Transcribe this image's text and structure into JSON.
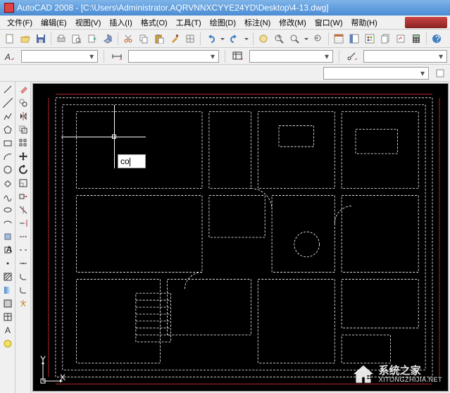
{
  "title": "AutoCAD 2008 - [C:\\Users\\Administrator.AQRVNNXCYYE24YD\\Desktop\\4-13.dwg]",
  "menu": {
    "file": "文件(F)",
    "edit": "编辑(E)",
    "view": "视图(V)",
    "insert": "插入(I)",
    "format": "格式(O)",
    "tools": "工具(T)",
    "draw": "绘图(D)",
    "dimension": "标注(N)",
    "modify": "修改(M)",
    "window": "窗口(W)",
    "help": "帮助(H)"
  },
  "toolbar_icons": {
    "new": "□",
    "open": "📂",
    "save": "💾",
    "plot": "🖶",
    "preview": "🔍",
    "publish": "📤",
    "cut": "✂",
    "copy": "📋",
    "paste": "📄",
    "match": "🖌",
    "undo": "↶",
    "redo": "↷",
    "pan": "✋",
    "zoomrt": "🔍",
    "zoomw": "⊞",
    "zoomp": "⊟",
    "props": "📑",
    "dc": "🗂",
    "tp": "🎨",
    "sheet": "📊",
    "markup": "✎",
    "calc": "🖩",
    "help": "?"
  },
  "props": {
    "color_label": "",
    "layer_label": "",
    "ltype_label": "",
    "lweight_label": ""
  },
  "cmd_input": "co",
  "ucs": {
    "x": "X",
    "y": "Y"
  },
  "watermark": {
    "cn": "系统之家",
    "en": "XITONGZHIJIA.NET"
  },
  "left_tools": [
    "line",
    "xline",
    "pline",
    "polygon",
    "rect",
    "arc",
    "circle",
    "revcloud",
    "spline",
    "ellipse",
    "earc",
    "block",
    "point",
    "hatch",
    "grad",
    "region",
    "table",
    "mtext"
  ],
  "right_tools": [
    "erase",
    "copy",
    "mirror",
    "offset",
    "array",
    "move",
    "rotate",
    "scale",
    "stretch",
    "trim",
    "extend",
    "break",
    "join",
    "chamfer",
    "fillet",
    "explode"
  ],
  "colors": {
    "new": "#e8e8a0",
    "open": "#e0c060",
    "save": "#4a6aa8",
    "plot": "#888",
    "cut": "#c06020",
    "copy": "#d0a040",
    "paste": "#60a060",
    "match": "#a06040",
    "undo": "#4080c0",
    "redo": "#4080c0",
    "pan": "#d0a040",
    "zoom": "#888",
    "props": "#c07040",
    "dc": "#6080c0",
    "tp": "#a060a0",
    "calc": "#606060"
  }
}
